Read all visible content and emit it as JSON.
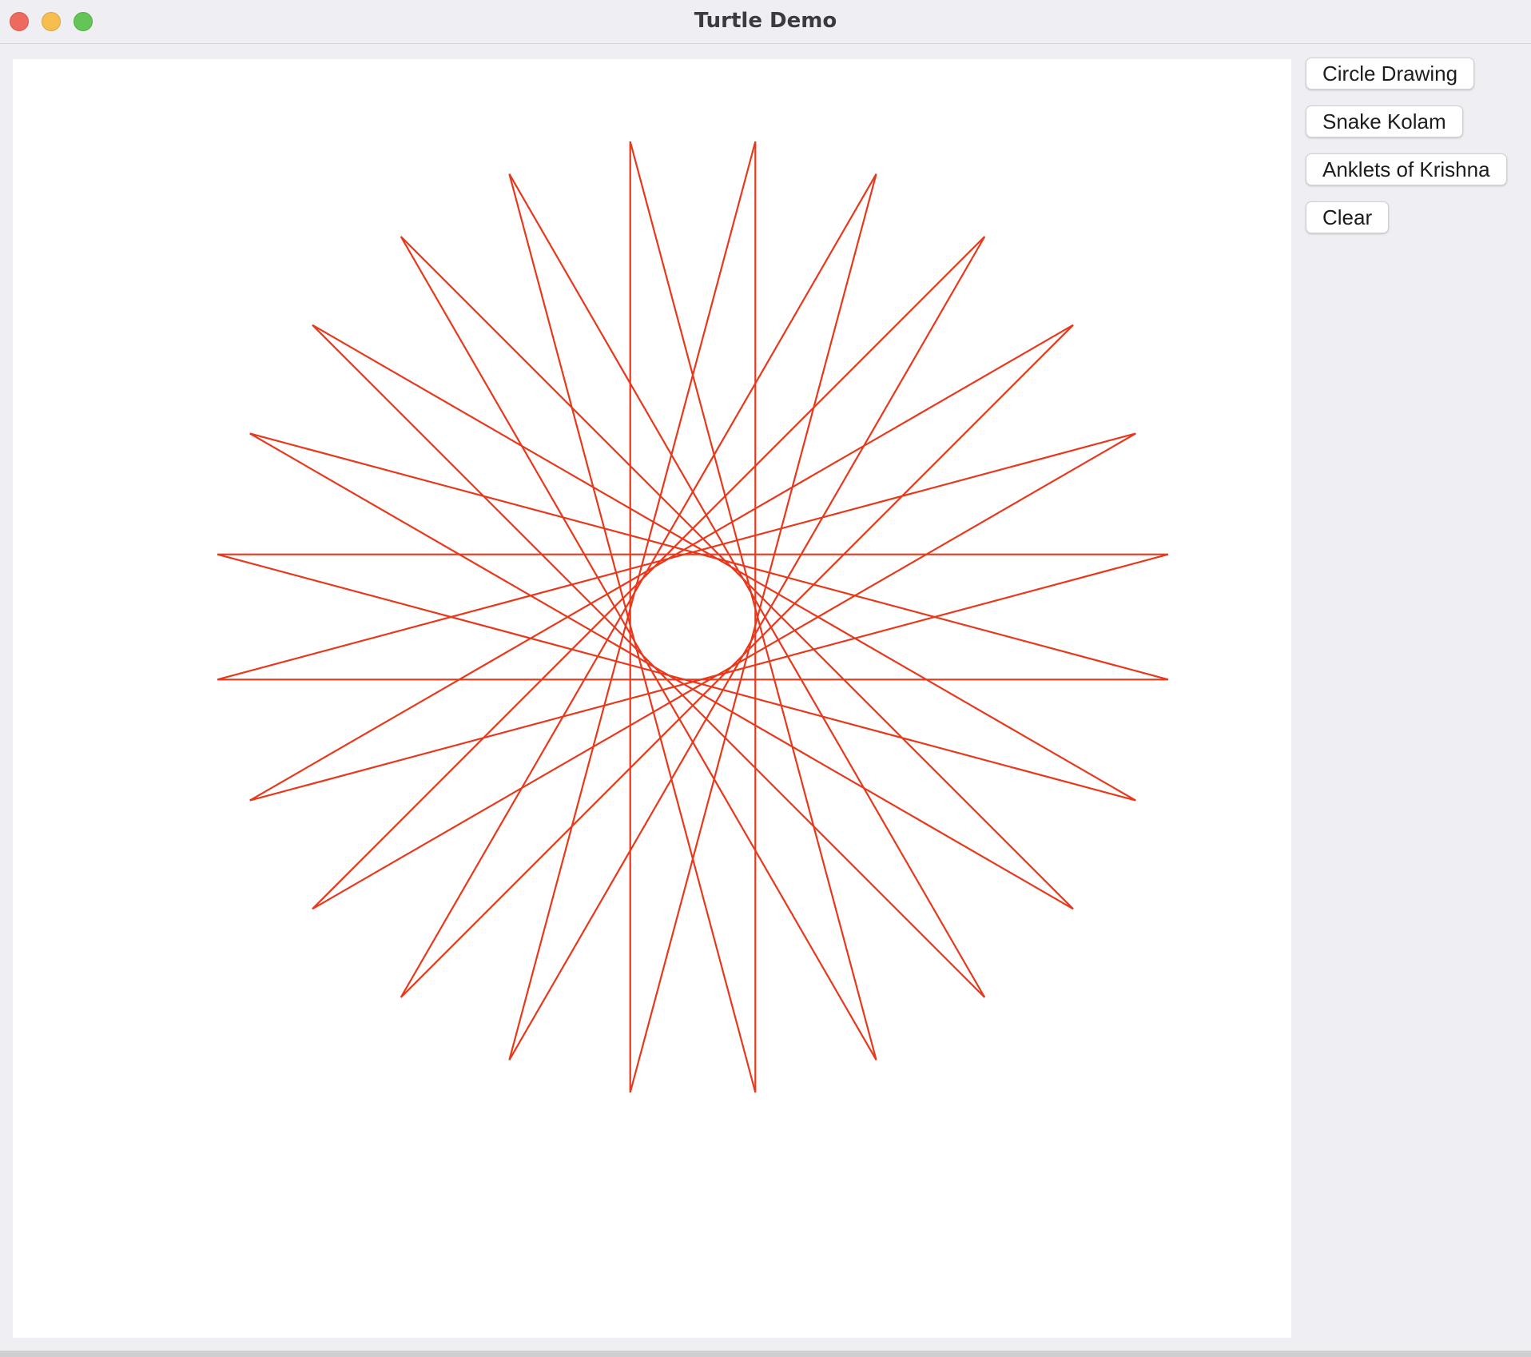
{
  "window": {
    "title": "Turtle Demo"
  },
  "buttons": [
    {
      "label": "Circle Drawing"
    },
    {
      "label": "Snake Kolam"
    },
    {
      "label": "Anklets of Krishna"
    },
    {
      "label": "Clear"
    }
  ],
  "drawing": {
    "pen_color": "#e8381c",
    "canvas_background": "#ffffff",
    "star_points": 24,
    "description_shape": "star-polygon"
  }
}
